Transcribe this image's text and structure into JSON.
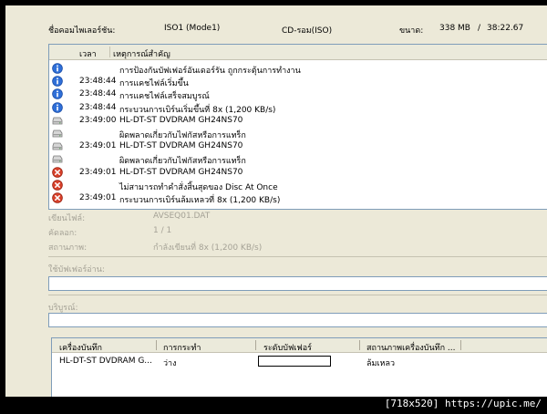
{
  "header": {
    "filename_label": "ชื่อคอมไพเลอร์ชัน:",
    "filename_value": "ISO1 (Mode1)",
    "format_value": "CD-รอม(ISO)",
    "size_label": "ขนาด:",
    "size_value": "338 MB",
    "duration_value": "38:22.67"
  },
  "log": {
    "columns": [
      "เวลา",
      "เหตุการณ์สำคัญ"
    ],
    "rows": [
      {
        "icon": "info-icon",
        "time": "",
        "msg": "การป้องกันบัฟเฟอร์อันเดอร์รัน ถูกกระตุ้นการทำงาน"
      },
      {
        "icon": "info-icon",
        "time": "23:48:44",
        "msg": "การแคชไฟล์เริ่มขึ้น"
      },
      {
        "icon": "info-icon",
        "time": "23:48:44",
        "msg": "การแคชไฟล์เสร็จสมบูรณ์"
      },
      {
        "icon": "info-icon",
        "time": "23:48:44",
        "msg": "กระบวนการเบิร์นเริ่มขึ้นที่ 8x (1,200 KB/s)"
      },
      {
        "icon": "drive-icon",
        "time": "23:49:00",
        "msg": "HL-DT-ST DVDRAM GH24NS70"
      },
      {
        "icon": "drive-icon",
        "time": "",
        "msg": "ผิดพลาดเกี่ยวกับไฟกัสหรือการแทร็ก"
      },
      {
        "icon": "drive-icon",
        "time": "23:49:01",
        "msg": "HL-DT-ST DVDRAM GH24NS70"
      },
      {
        "icon": "drive-icon",
        "time": "",
        "msg": "ผิดพลาดเกี่ยวกับไฟกัสหรือการแทร็ก"
      },
      {
        "icon": "error-icon",
        "time": "23:49:01",
        "msg": "HL-DT-ST DVDRAM GH24NS70"
      },
      {
        "icon": "error-icon",
        "time": "",
        "msg": "ไม่สามารถทำคำสั่งสิ้นสุดของ Disc At Once"
      },
      {
        "icon": "error-icon",
        "time": "23:49:01",
        "msg": "กระบวนการเบิร์นล้มเหลวที่ 8x (1,200 KB/s)"
      }
    ]
  },
  "details": {
    "write_file_label": "เขียนไฟล์:",
    "write_file_value": "AVSEQ01.DAT",
    "copy_label": "คัดลอก:",
    "copy_value": "1 / 1",
    "status_label": "สถานภาพ:",
    "status_value": "กำลังเขียนที่ 8x (1,200 KB/s)",
    "buffer_label": "ใช้บัฟเฟอร์อ่าน:",
    "complete_label": "บริบูรณ์:"
  },
  "recorders": {
    "columns": [
      "เครื่องบันทึก",
      "การกระทำ",
      "ระดับบัฟเฟอร์",
      "สถานภาพเครื่องบันทึก ..."
    ],
    "rows": [
      {
        "recorder": "HL-DT-ST DVDRAM G...",
        "action": "ว่าง",
        "status": "ล้มเหลว"
      }
    ]
  },
  "watermark": "[718x520] https://upic.me/",
  "colors": {
    "info": "#2f6fd8",
    "error": "#d8402a",
    "frame": "#ece9d8"
  }
}
